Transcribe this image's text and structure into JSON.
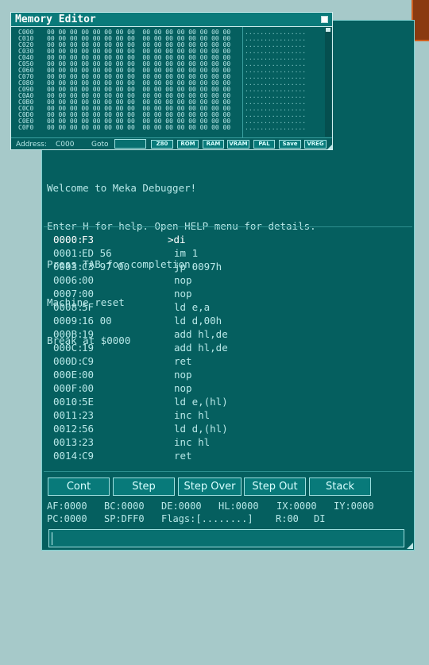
{
  "debugger": {
    "console_lines": [
      "Welcome to Meka Debugger!",
      "Enter H for help. Open HELP menu for details.",
      "Press TAB for completion.",
      "Machine reset",
      "Break at $0000"
    ],
    "disasm": [
      {
        "addr": "0000:",
        "bytes": "F3",
        "instr": ">di"
      },
      {
        "addr": "0001:",
        "bytes": "ED 56",
        "instr": "im 1"
      },
      {
        "addr": "0003:",
        "bytes": "C3 97 00",
        "instr": "jp 0097h"
      },
      {
        "addr": "0006:",
        "bytes": "00",
        "instr": "nop"
      },
      {
        "addr": "0007:",
        "bytes": "00",
        "instr": "nop"
      },
      {
        "addr": "0008:",
        "bytes": "5F",
        "instr": "ld e,a"
      },
      {
        "addr": "0009:",
        "bytes": "16 00",
        "instr": "ld d,00h"
      },
      {
        "addr": "000B:",
        "bytes": "19",
        "instr": "add hl,de"
      },
      {
        "addr": "000C:",
        "bytes": "19",
        "instr": "add hl,de"
      },
      {
        "addr": "000D:",
        "bytes": "C9",
        "instr": "ret"
      },
      {
        "addr": "000E:",
        "bytes": "00",
        "instr": "nop"
      },
      {
        "addr": "000F:",
        "bytes": "00",
        "instr": "nop"
      },
      {
        "addr": "0010:",
        "bytes": "5E",
        "instr": "ld e,(hl)"
      },
      {
        "addr": "0011:",
        "bytes": "23",
        "instr": "inc hl"
      },
      {
        "addr": "0012:",
        "bytes": "56",
        "instr": "ld d,(hl)"
      },
      {
        "addr": "0013:",
        "bytes": "23",
        "instr": "inc hl"
      },
      {
        "addr": "0014:",
        "bytes": "C9",
        "instr": "ret"
      }
    ],
    "buttons": {
      "cont": "Cont",
      "step": "Step",
      "step_over": "Step Over",
      "step_out": "Step Out",
      "stack": "Stack"
    },
    "registers": {
      "af": "AF:0000",
      "bc": "BC:0000",
      "de": "DE:0000",
      "hl": "HL:0000",
      "ix": "IX:0000",
      "iy": "IY:0000",
      "pc": "PC:0000",
      "sp": "SP:DFF0",
      "flags": "Flags:[........]",
      "r": "R:00",
      "int": "DI"
    },
    "command_value": ""
  },
  "memory_editor": {
    "title": "Memory Editor",
    "rows": [
      "C000",
      "C010",
      "C020",
      "C030",
      "C040",
      "C050",
      "C060",
      "C070",
      "C080",
      "C090",
      "C0A0",
      "C0B0",
      "C0C0",
      "C0D0",
      "C0E0",
      "C0F0"
    ],
    "hex_row": "00 00 00 00 00 00 00 00  00 00 00 00 00 00 00 00",
    "ascii_row": "................",
    "address_label": "Address:",
    "address_value": "C000",
    "goto_label": "Goto",
    "goto_value": "",
    "buttons": {
      "z80": "Z80",
      "rom": "ROM",
      "ram": "RAM",
      "vram": "VRAM",
      "pal": "PAL",
      "save": "Save",
      "vreg": "VREG"
    }
  },
  "colors": {
    "window_bg": "#055f5f",
    "desktop_bg": "#a6c9c9",
    "text": "#b8e8e8",
    "border": "#9ee0e0"
  }
}
